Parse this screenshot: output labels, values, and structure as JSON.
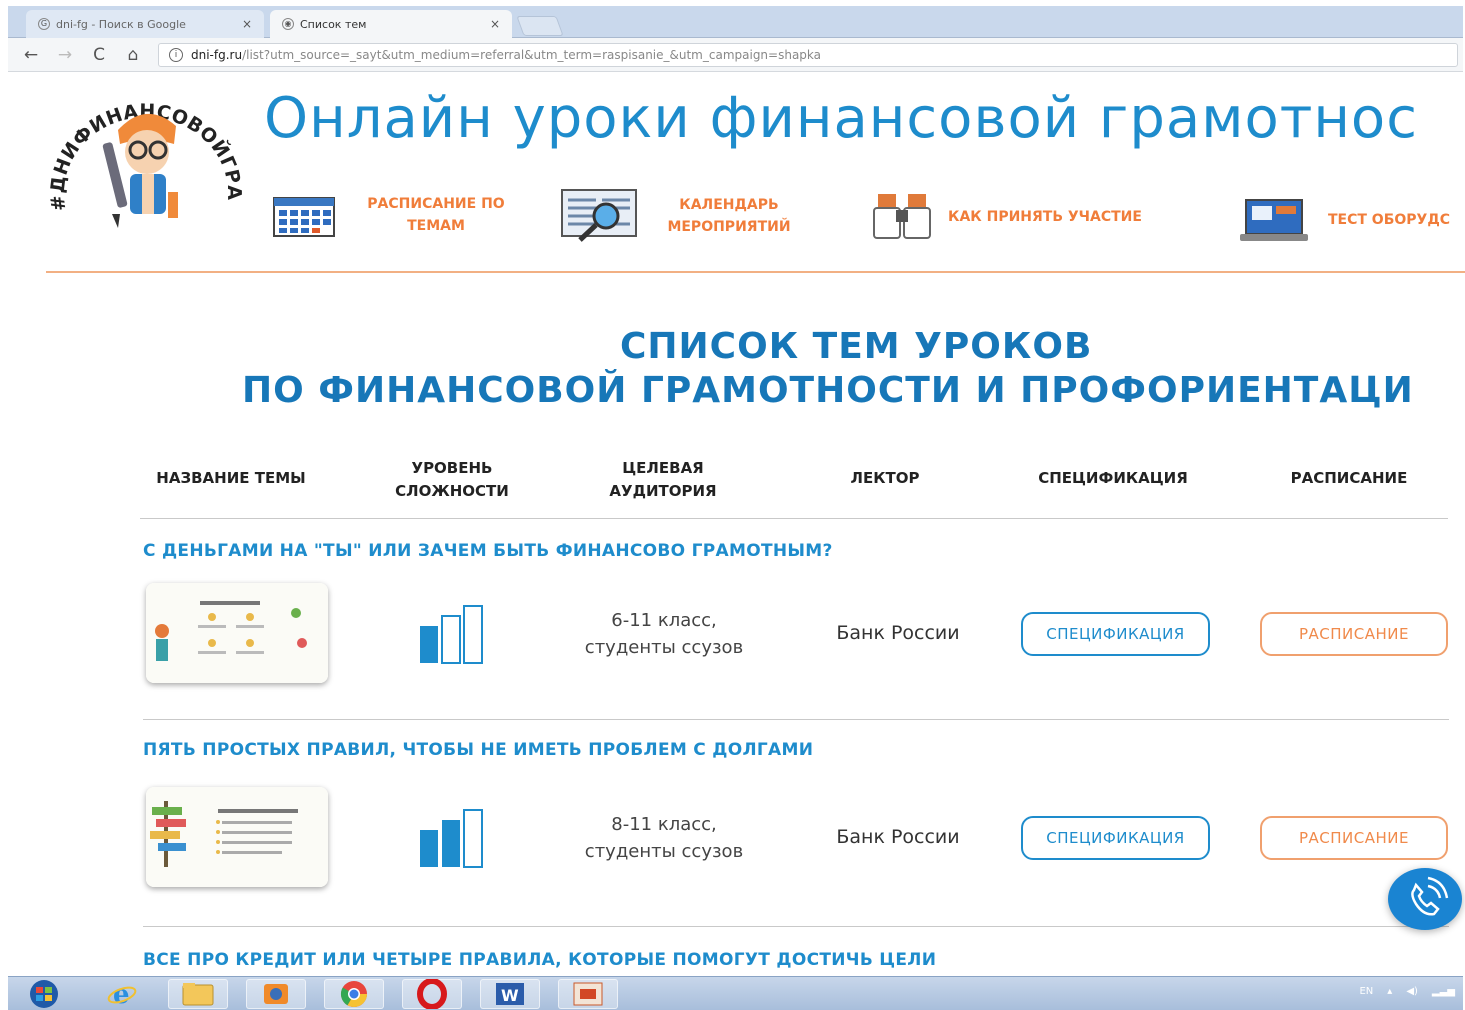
{
  "browser": {
    "tabs": [
      {
        "title": "dni-fg - Поиск в Google",
        "close": "×",
        "active": false
      },
      {
        "title": "Список тем",
        "close": "×",
        "active": true
      }
    ],
    "address": {
      "host": "dni-fg.ru",
      "path": "/list?utm_source=_sayt&utm_medium=referral&utm_term=raspisanie_&utm_campaign=shapka"
    },
    "nav": {
      "back": "←",
      "forward": "→",
      "reload": "C",
      "home": "⌂",
      "info": "i"
    }
  },
  "site": {
    "logo_text": "#ДНИФИНАНСОВОЙГРАМОТНОСТИ",
    "title": "Онлайн уроки финансовой грамотнос",
    "menu": [
      {
        "label_line1": "РАСПИСАНИЕ ПО",
        "label_line2": "ТЕМАМ",
        "icon": "calendar-icon"
      },
      {
        "label_line1": "КАЛЕНДАРЬ",
        "label_line2": "МЕРОПРИЯТИЙ",
        "icon": "schedule-magnifier-icon"
      },
      {
        "label_line1": "КАК ПРИНЯТЬ УЧАСТИЕ",
        "label_line2": "",
        "icon": "binoculars-icon"
      },
      {
        "label_line1": "ТЕСТ ОБОРУДС",
        "label_line2": "",
        "icon": "computer-icon"
      }
    ]
  },
  "heading": {
    "line1": "СПИСОК ТЕМ УРОКОВ",
    "line2": "ПО ФИНАНСОВОЙ ГРАМОТНОСТИ И ПРОФОРИЕНТАЦИ"
  },
  "table": {
    "columns": [
      {
        "line1": "НАЗВАНИЕ ТЕМЫ",
        "line2": ""
      },
      {
        "line1": "УРОВЕНЬ",
        "line2": "СЛОЖНОСТИ"
      },
      {
        "line1": "ЦЕЛЕВАЯ",
        "line2": "АУДИТОРИЯ"
      },
      {
        "line1": "ЛЕКТОР",
        "line2": ""
      },
      {
        "line1": "СПЕЦИФИКАЦИЯ",
        "line2": ""
      },
      {
        "line1": "РАСПИСАНИЕ",
        "line2": ""
      }
    ],
    "rows": [
      {
        "title": "С ДЕНЬГАМИ НА \"ТЫ\" ИЛИ ЗАЧЕМ БЫТЬ ФИНАНСОВО ГРАМОТНЫМ?",
        "level_filled": 1,
        "level_total": 3,
        "audience_line1": "6-11 класс,",
        "audience_line2": "студенты ссузов",
        "lector": "Банк России",
        "spec_button": "СПЕЦИФИКАЦИЯ",
        "schedule_button": "РАСПИСАНИЕ"
      },
      {
        "title": "ПЯТЬ ПРОСТЫХ ПРАВИЛ, ЧТОБЫ НЕ ИМЕТЬ ПРОБЛЕМ С ДОЛГАМИ",
        "level_filled": 2,
        "level_total": 3,
        "audience_line1": "8-11 класс,",
        "audience_line2": "студенты ссузов",
        "lector": "Банк России",
        "spec_button": "СПЕЦИФИКАЦИЯ",
        "schedule_button": "РАСПИСАНИЕ"
      },
      {
        "title": "ВСЕ ПРО КРЕДИТ ИЛИ ЧЕТЫРЕ ПРАВИЛА, КОТОРЫЕ ПОМОГУТ ДОСТИЧЬ ЦЕЛИ"
      }
    ]
  },
  "taskbar": {
    "apps": [
      "windows-start-icon",
      "internet-explorer-icon",
      "file-explorer-icon",
      "media-player-icon",
      "chrome-icon",
      "opera-icon",
      "word-icon",
      "powerpoint-icon"
    ],
    "tray_lang": "EN"
  },
  "colors": {
    "brand_blue": "#1e8ccc",
    "heading_blue": "#1777b8",
    "accent_orange": "#f07d3a"
  }
}
